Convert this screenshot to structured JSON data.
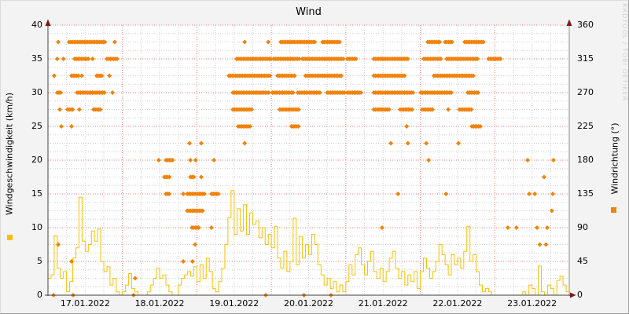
{
  "title": "Wind",
  "watermark": "RRDTOOL / TOBI OETIKER",
  "axes": {
    "left": {
      "label": "Windgeschwindigkeit (km/h)",
      "ticks": [
        0,
        5,
        10,
        15,
        20,
        25,
        30,
        35,
        40
      ],
      "range": [
        0,
        40
      ]
    },
    "right": {
      "label": "Windrichtung (°)",
      "ticks": [
        0,
        45,
        90,
        135,
        180,
        225,
        270,
        315,
        360
      ],
      "range": [
        0,
        360
      ]
    },
    "x": {
      "labels": [
        "17.01.2022",
        "18.01.2022",
        "19.01.2022",
        "20.01.2022",
        "21.01.2022",
        "22.01.2022",
        "23.01.2022"
      ]
    }
  },
  "colors": {
    "background": "#f3f3f3",
    "canvas": "#ffffff",
    "minor_grid": "#cfcfcf",
    "major_grid": "#ee7d7d",
    "axis": "#404040",
    "right_axis": "#8c8c8c",
    "arrow": "#7f1a1a",
    "speed": "#f8c000",
    "direction": "#f0830d",
    "watermark": "#d2d2d2"
  },
  "legend": {
    "speed_swatch_color": "#f8c000",
    "direction_swatch_color": "#f0830d"
  },
  "chart_data": {
    "type": "line",
    "title": "Wind",
    "xlabel": "",
    "x_start": "17.01.2022 00:00",
    "x_end": "24.01.2022 00:00",
    "x_tick_labels": [
      "17.01.2022",
      "18.01.2022",
      "19.01.2022",
      "20.01.2022",
      "21.01.2022",
      "22.01.2022",
      "23.01.2022"
    ],
    "grid": {
      "major_x_hours": 24,
      "minor_x_hours": 6,
      "major_y_left": 5,
      "minor_y_left": 1.25
    },
    "ylim_left": [
      0,
      40
    ],
    "ylim_right": [
      0,
      360
    ],
    "ylabel_left": "Windgeschwindigkeit (km/h)",
    "ylabel_right": "Windrichtung (°)",
    "series": [
      {
        "name": "Windgeschwindigkeit",
        "type": "line",
        "render": "step",
        "axis": "left",
        "unit": "km/h",
        "color": "#f8c000",
        "step_hours": 1,
        "values": [
          2.5,
          3,
          8.8,
          4,
          2.5,
          3.5,
          0.5,
          2,
          5.5,
          7,
          14.5,
          8,
          6.5,
          7.5,
          9.5,
          8,
          9.8,
          5,
          3.5,
          4.2,
          1.5,
          2.5,
          0.5,
          0,
          0.5,
          1.5,
          3.2,
          1,
          0.5,
          0,
          0,
          0,
          0.5,
          1.5,
          2.5,
          4,
          2.5,
          3,
          1.5,
          0.5,
          0,
          0,
          1.5,
          2.5,
          3,
          3.5,
          2.8,
          4.2,
          2,
          4.5,
          2.5,
          5.5,
          3.5,
          1,
          0.5,
          2,
          4,
          7.5,
          11.5,
          15.5,
          9,
          12.8,
          9.5,
          13.4,
          9,
          12.2,
          10.5,
          11,
          8.5,
          10,
          7.5,
          9,
          7,
          10.2,
          5.5,
          4,
          6.5,
          3.5,
          5,
          11.4,
          4.5,
          8.7,
          5.5,
          7.5,
          6,
          9,
          7.5,
          4.5,
          3,
          1.5,
          2.5,
          1,
          2,
          0.5,
          1.5,
          0.5,
          2,
          4.5,
          3,
          6,
          7,
          4.5,
          3,
          5,
          6.5,
          3.5,
          2.5,
          4,
          2,
          3.5,
          5.5,
          6.5,
          4,
          2.5,
          3.5,
          1.5,
          3,
          2,
          3.5,
          1,
          3.5,
          5.5,
          4,
          2.5,
          3.5,
          5,
          7.5,
          6,
          4.5,
          3,
          6,
          4.5,
          5.5,
          4,
          6.5,
          10.2,
          5,
          6,
          3.5,
          1.5,
          0.5,
          1,
          0.5,
          0,
          0,
          0,
          0,
          0,
          0,
          0,
          0,
          0,
          0,
          0.5,
          0,
          1.5,
          1,
          0,
          4.3,
          0.5,
          0,
          1.5,
          1,
          0,
          2.2,
          2.8,
          1.5,
          0.5,
          0
        ]
      },
      {
        "name": "Windrichtung",
        "type": "scatter",
        "axis": "right",
        "unit": "°",
        "color": "#f0830d",
        "marker": "diamond",
        "point_spacing_hours": 0.55,
        "segments_hours_deg": [
          [
            3.3,
            3.3,
            337.5
          ],
          [
            6.8,
            18.5,
            337.5
          ],
          [
            21.5,
            21.5,
            337.5
          ],
          [
            63.4,
            63.4,
            337.5
          ],
          [
            71,
            71,
            337.5
          ],
          [
            75,
            86,
            337.5
          ],
          [
            88.5,
            94,
            337.5
          ],
          [
            122.4,
            126.7,
            337.5
          ],
          [
            128,
            130.5,
            337.5
          ],
          [
            134.3,
            140.4,
            337.5
          ],
          [
            3,
            3,
            315
          ],
          [
            5,
            5,
            315
          ],
          [
            8.6,
            13.4,
            315
          ],
          [
            14.4,
            14.4,
            315
          ],
          [
            19,
            22.3,
            315
          ],
          [
            60.8,
            71.8,
            315
          ],
          [
            72.7,
            81,
            315
          ],
          [
            82,
            95.4,
            315
          ],
          [
            96.5,
            99.6,
            315
          ],
          [
            105,
            116,
            315
          ],
          [
            121.1,
            127,
            315
          ],
          [
            128.5,
            138.9,
            315
          ],
          [
            142,
            146,
            315
          ],
          [
            2,
            2,
            292.5
          ],
          [
            7.6,
            10,
            292.5
          ],
          [
            10.9,
            10.9,
            292.5
          ],
          [
            15.7,
            17.7,
            292.5
          ],
          [
            19.8,
            19.8,
            292.5
          ],
          [
            58.3,
            71.5,
            292.5
          ],
          [
            74,
            80,
            292.5
          ],
          [
            83,
            95,
            292.5
          ],
          [
            105,
            115,
            292.5
          ],
          [
            124.4,
            137.1,
            292.5
          ],
          [
            3,
            4.3,
            270
          ],
          [
            9.4,
            18.2,
            270
          ],
          [
            20.8,
            20.8,
            270
          ],
          [
            59.6,
            71.5,
            270
          ],
          [
            72.4,
            79,
            270
          ],
          [
            80.5,
            88,
            270
          ],
          [
            90,
            95.5,
            270
          ],
          [
            96.5,
            101,
            270
          ],
          [
            105,
            118,
            270
          ],
          [
            120.1,
            130.2,
            270
          ],
          [
            135.3,
            138.9,
            270
          ],
          [
            3.8,
            3.8,
            247.5
          ],
          [
            6.3,
            8.4,
            247.5
          ],
          [
            10.1,
            10.1,
            247.5
          ],
          [
            14.7,
            17.2,
            247.5
          ],
          [
            59.6,
            65.9,
            247.5
          ],
          [
            74.7,
            81,
            247.5
          ],
          [
            105,
            110,
            247.5
          ],
          [
            113.5,
            117.6,
            247.5
          ],
          [
            120.6,
            124.4,
            247.5
          ],
          [
            129,
            129,
            247.5
          ],
          [
            132.6,
            136.6,
            247.5
          ],
          [
            4.3,
            4.3,
            225
          ],
          [
            7.6,
            7.6,
            225
          ],
          [
            61.3,
            65.4,
            225
          ],
          [
            78.5,
            81,
            225
          ],
          [
            115.6,
            115.6,
            225
          ],
          [
            136.6,
            139.4,
            225
          ],
          [
            45.6,
            45.6,
            202.5
          ],
          [
            49.4,
            49.4,
            202.5
          ],
          [
            63.4,
            63.4,
            202.5
          ],
          [
            110.5,
            110.5,
            202.5
          ],
          [
            116,
            116,
            202.5
          ],
          [
            121.9,
            121.9,
            202.5
          ],
          [
            132.3,
            132.3,
            202.5
          ],
          [
            35.7,
            35.7,
            180
          ],
          [
            38,
            40.5,
            180
          ],
          [
            45.9,
            45.9,
            180
          ],
          [
            47.6,
            47.6,
            180
          ],
          [
            53.5,
            53.5,
            180
          ],
          [
            122.7,
            122.7,
            180
          ],
          [
            154.6,
            154.6,
            180
          ],
          [
            162.9,
            163.2,
            180
          ],
          [
            37.5,
            39.3,
            157.5
          ],
          [
            45.9,
            47.4,
            157.5
          ],
          [
            49.4,
            49.4,
            157.5
          ],
          [
            159.9,
            159.9,
            157.5
          ],
          [
            38,
            39.3,
            135
          ],
          [
            43.6,
            43.6,
            135
          ],
          [
            44.9,
            50.8,
            135
          ],
          [
            52.7,
            55,
            135
          ],
          [
            112.8,
            112.8,
            135
          ],
          [
            128.3,
            128.3,
            135
          ],
          [
            155.1,
            155.1,
            135
          ],
          [
            156.9,
            156.9,
            135
          ],
          [
            162.7,
            162.7,
            135
          ],
          [
            44.9,
            49.9,
            112.5
          ],
          [
            162.4,
            162.4,
            112.5
          ],
          [
            46.4,
            48.9,
            90
          ],
          [
            52.7,
            52.7,
            90
          ],
          [
            107.7,
            107.7,
            90
          ],
          [
            148.2,
            148.2,
            90
          ],
          [
            151,
            151,
            90
          ],
          [
            157.6,
            157.6,
            90
          ],
          [
            160.9,
            160.9,
            90
          ],
          [
            3.3,
            3.3,
            67.5
          ],
          [
            47.4,
            47.4,
            67.5
          ],
          [
            158.5,
            158.5,
            67.5
          ],
          [
            160.5,
            160.5,
            67.5
          ],
          [
            7.6,
            7.6,
            45
          ],
          [
            43.6,
            43.6,
            45
          ],
          [
            46.6,
            46.6,
            45
          ],
          [
            28.1,
            28.1,
            22.5
          ],
          [
            1.8,
            1.8,
            0
          ],
          [
            8.1,
            8.1,
            0
          ],
          [
            27.6,
            27.6,
            0
          ],
          [
            70.2,
            70.2,
            0
          ],
          [
            82.5,
            82.5,
            0
          ],
          [
            91.2,
            91.2,
            0
          ]
        ]
      }
    ]
  }
}
